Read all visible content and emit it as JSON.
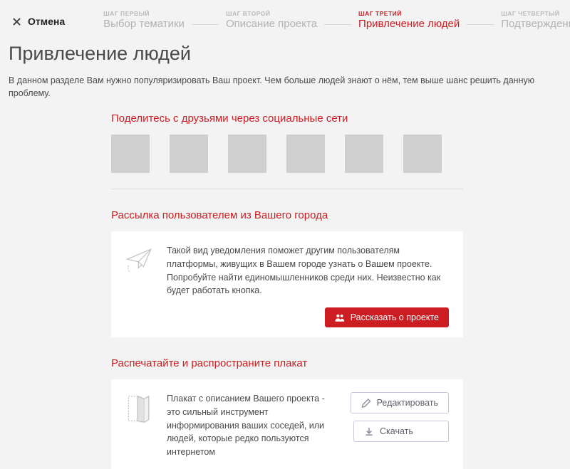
{
  "topbar": {
    "cancel_label": "Отмена"
  },
  "steps": [
    {
      "caption": "ШАГ ПЕРВЫЙ",
      "title": "Выбор тематики"
    },
    {
      "caption": "ШАГ ВТОРОЙ",
      "title": "Описание проекта"
    },
    {
      "caption": "ШАГ ТРЕТИЙ",
      "title": "Привлечение людей"
    },
    {
      "caption": "ШАГ ЧЕТВЕРТЫЙ",
      "title": "Подтверждение"
    }
  ],
  "page": {
    "heading": "Привлечение людей",
    "description": "В данном разделе Вам нужно популяризировать Ваш проект. Чем больше людей знают о нём, тем выше шанс решить данную проблему."
  },
  "social": {
    "heading": "Поделитесь с друзьями через социальные сети"
  },
  "broadcast": {
    "heading": "Рассылка пользователем из Вашего города",
    "text": "Такой вид уведомления поможет другим пользователям платформы, живущих в Вашем городе узнать о Вашем проекте. Попробуйте найти единомышленников среди них. Неизвестно как будет работать кнопка.",
    "button_label": "Рассказать о проекте"
  },
  "poster": {
    "heading": "Распечатайте и распространите плакат",
    "text": "Плакат с описанием Вашего проекта - это сильный инструмент информирования ваших соседей, или людей, которые редко пользуются интернетом",
    "edit_label": "Редактировать",
    "download_label": "Скачать"
  }
}
